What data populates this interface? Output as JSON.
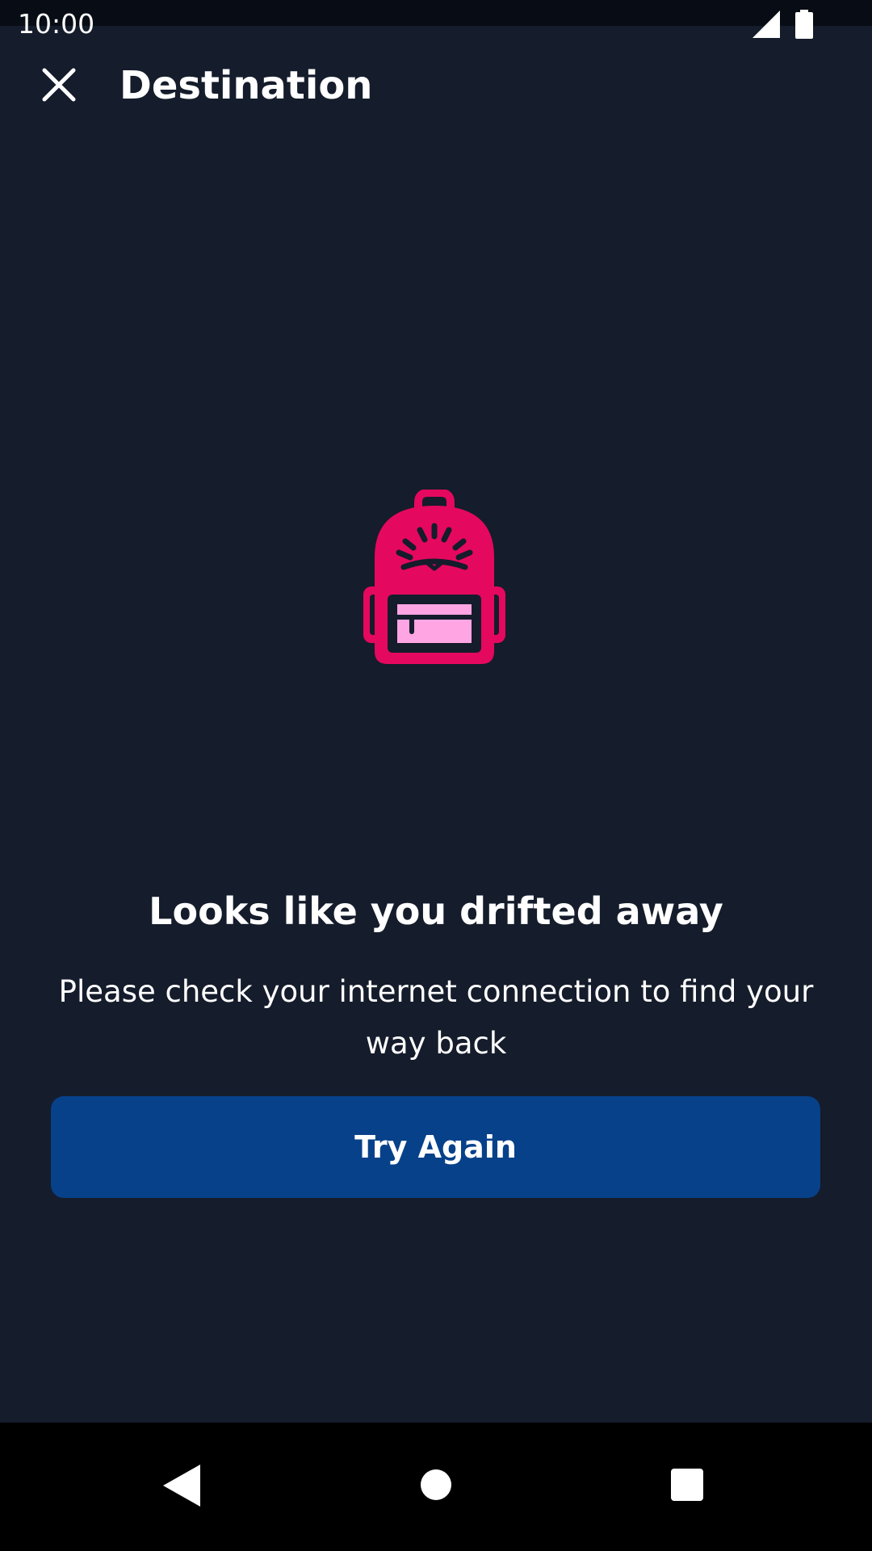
{
  "status_bar": {
    "time": "10:00",
    "icons": [
      "signal-icon",
      "battery-icon"
    ]
  },
  "app_bar": {
    "close_icon": "close-icon",
    "title": "Destination"
  },
  "illustration": {
    "icon": "backpack-icon",
    "colors": {
      "body": "#e5085f",
      "pocket": "#ffa5e3",
      "outline": "#151c2b"
    }
  },
  "message": {
    "headline": "Looks like you drifted away",
    "body": "Please check your internet connection to find your way back"
  },
  "actions": {
    "try_again_label": "Try Again"
  },
  "nav_bar": {
    "icons": [
      "back-icon",
      "home-icon",
      "recents-icon"
    ]
  },
  "colors": {
    "background": "#151c2b",
    "status_bar": "#080c14",
    "primary_button": "#07418a",
    "text": "#ffffff"
  }
}
